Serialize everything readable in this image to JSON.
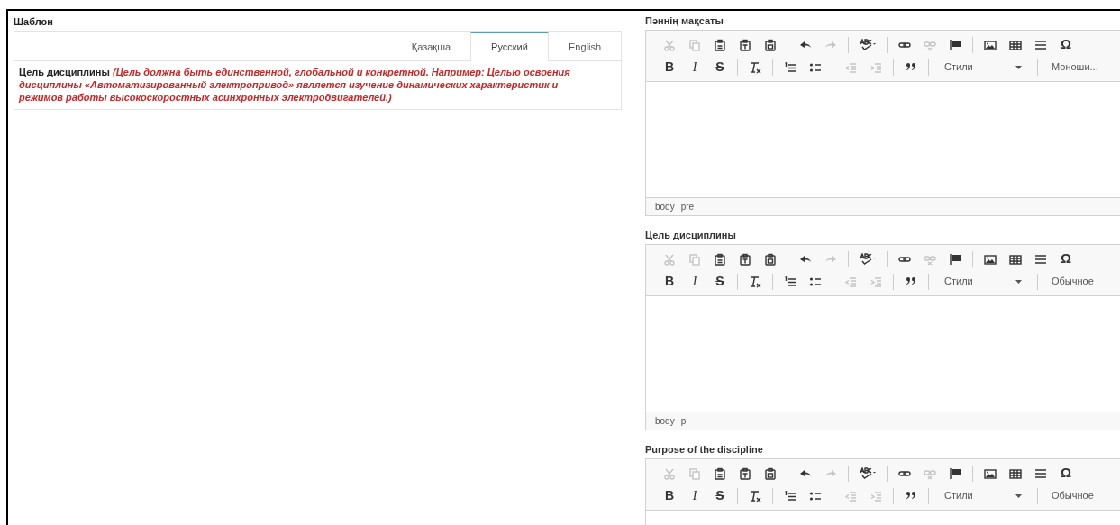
{
  "template": {
    "title": "Шаблон",
    "tabs": [
      {
        "label": "Қазақша",
        "selected": false
      },
      {
        "label": "Русский",
        "selected": true
      },
      {
        "label": "English",
        "selected": false
      }
    ],
    "content": "**Цель дисциплины** *(Цель должна быть единственной, глобальной и конкретной. Например: Целью освоения дисциплины «Автоматизированный электропривод» является изучение динамических характеристик и режимов работы высокоскоростных асинхронных электродвигателей.)*"
  },
  "editors": [
    {
      "label": "Пәннің мақсаты",
      "path": [
        "body",
        "pre"
      ],
      "toolbar_row_1": [
        {
          "kind": "button",
          "disabled": true
        },
        {
          "kind": "button",
          "disabled": true
        },
        {
          "kind": "button",
          "disabled": false
        },
        {
          "kind": "button",
          "disabled": false
        },
        {
          "kind": "button",
          "disabled": false
        },
        {
          "kind": "sep"
        },
        {
          "kind": "button",
          "disabled": false
        },
        {
          "kind": "button",
          "disabled": true
        },
        {
          "kind": "sep"
        },
        {
          "kind": "button",
          "disabled": false
        },
        {
          "kind": "sep"
        },
        {
          "kind": "button",
          "disabled": false
        },
        {
          "kind": "button",
          "disabled": true
        },
        {
          "kind": "button",
          "disabled": false
        },
        {
          "kind": "sep"
        },
        {
          "kind": "button",
          "disabled": false
        },
        {
          "kind": "button",
          "disabled": false
        },
        {
          "kind": "button",
          "disabled": false
        },
        {
          "kind": "glyph",
          "label": "Ω",
          "disabled": false
        }
      ],
      "toolbar_row_2": [
        {
          "kind": "glyph",
          "label": "B",
          "disabled": false
        },
        {
          "kind": "glyph",
          "label": "I",
          "disabled": false
        },
        {
          "kind": "glyph",
          "label": "S",
          "disabled": false
        },
        {
          "kind": "sep"
        },
        {
          "kind": "button",
          "disabled": false
        },
        {
          "kind": "sep"
        },
        {
          "kind": "button",
          "disabled": false
        },
        {
          "kind": "button",
          "disabled": false
        },
        {
          "kind": "sep"
        },
        {
          "kind": "button",
          "disabled": true
        },
        {
          "kind": "button",
          "disabled": true
        },
        {
          "kind": "sep"
        },
        {
          "kind": "button",
          "disabled": false
        },
        {
          "kind": "sep"
        },
        {
          "kind": "styles",
          "label": "Стили"
        },
        {
          "kind": "sep"
        },
        {
          "kind": "format",
          "label": "Моноши..."
        }
      ]
    },
    {
      "label": "Цель дисциплины",
      "path": [
        "body",
        "p"
      ],
      "toolbar_row_1": [
        {
          "kind": "button",
          "disabled": true
        },
        {
          "kind": "button",
          "disabled": true
        },
        {
          "kind": "button",
          "disabled": false
        },
        {
          "kind": "button",
          "disabled": false
        },
        {
          "kind": "button",
          "disabled": false
        },
        {
          "kind": "sep"
        },
        {
          "kind": "button",
          "disabled": false
        },
        {
          "kind": "button",
          "disabled": true
        },
        {
          "kind": "sep"
        },
        {
          "kind": "button",
          "disabled": false
        },
        {
          "kind": "sep"
        },
        {
          "kind": "button",
          "disabled": false
        },
        {
          "kind": "button",
          "disabled": true
        },
        {
          "kind": "button",
          "disabled": false
        },
        {
          "kind": "sep"
        },
        {
          "kind": "button",
          "disabled": false
        },
        {
          "kind": "button",
          "disabled": false
        },
        {
          "kind": "button",
          "disabled": false
        },
        {
          "kind": "glyph",
          "label": "Ω",
          "disabled": false
        }
      ],
      "toolbar_row_2": [
        {
          "kind": "glyph",
          "label": "B",
          "disabled": false
        },
        {
          "kind": "glyph",
          "label": "I",
          "disabled": false
        },
        {
          "kind": "glyph",
          "label": "S",
          "disabled": false
        },
        {
          "kind": "sep"
        },
        {
          "kind": "button",
          "disabled": false
        },
        {
          "kind": "sep"
        },
        {
          "kind": "button",
          "disabled": false
        },
        {
          "kind": "button",
          "disabled": false
        },
        {
          "kind": "sep"
        },
        {
          "kind": "button",
          "disabled": true
        },
        {
          "kind": "button",
          "disabled": true
        },
        {
          "kind": "sep"
        },
        {
          "kind": "button",
          "disabled": false
        },
        {
          "kind": "sep"
        },
        {
          "kind": "styles",
          "label": "Стили"
        },
        {
          "kind": "sep"
        },
        {
          "kind": "format",
          "label": "Обычное"
        }
      ]
    },
    {
      "label": "Purpose of the discipline",
      "toolbar_row_1": [
        {
          "kind": "button",
          "disabled": true
        },
        {
          "kind": "button",
          "disabled": true
        },
        {
          "kind": "button",
          "disabled": false
        },
        {
          "kind": "button",
          "disabled": false
        },
        {
          "kind": "button",
          "disabled": false
        },
        {
          "kind": "sep"
        },
        {
          "kind": "button",
          "disabled": false
        },
        {
          "kind": "button",
          "disabled": true
        },
        {
          "kind": "sep"
        },
        {
          "kind": "button",
          "disabled": false
        },
        {
          "kind": "sep"
        },
        {
          "kind": "button",
          "disabled": false
        },
        {
          "kind": "button",
          "disabled": true
        },
        {
          "kind": "button",
          "disabled": false
        },
        {
          "kind": "sep"
        },
        {
          "kind": "button",
          "disabled": false
        },
        {
          "kind": "button",
          "disabled": false
        },
        {
          "kind": "button",
          "disabled": false
        },
        {
          "kind": "glyph",
          "label": "Ω",
          "disabled": false
        }
      ],
      "toolbar_row_2": [
        {
          "kind": "glyph",
          "label": "B",
          "disabled": false
        },
        {
          "kind": "glyph",
          "label": "I",
          "disabled": false
        },
        {
          "kind": "glyph",
          "label": "S",
          "disabled": false
        },
        {
          "kind": "sep"
        },
        {
          "kind": "button",
          "disabled": false
        },
        {
          "kind": "sep"
        },
        {
          "kind": "button",
          "disabled": false
        },
        {
          "kind": "button",
          "disabled": false
        },
        {
          "kind": "sep"
        },
        {
          "kind": "button",
          "disabled": true
        },
        {
          "kind": "button",
          "disabled": true
        },
        {
          "kind": "sep"
        },
        {
          "kind": "button",
          "disabled": false
        },
        {
          "kind": "sep"
        },
        {
          "kind": "styles",
          "label": "Стили"
        },
        {
          "kind": "sep"
        },
        {
          "kind": "format",
          "label": "Обычное"
        }
      ]
    }
  ]
}
